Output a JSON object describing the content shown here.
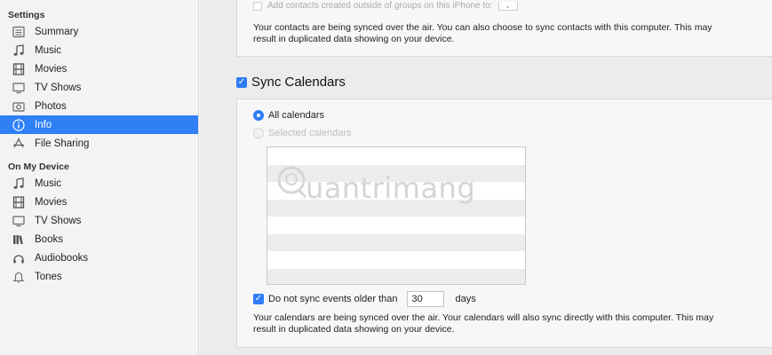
{
  "sidebar": {
    "settings_heading": "Settings",
    "settings_items": [
      {
        "label": "Summary",
        "icon": "summary-icon"
      },
      {
        "label": "Music",
        "icon": "music-note-icon"
      },
      {
        "label": "Movies",
        "icon": "film-icon"
      },
      {
        "label": "TV Shows",
        "icon": "tv-icon"
      },
      {
        "label": "Photos",
        "icon": "camera-icon"
      },
      {
        "label": "Info",
        "icon": "info-icon",
        "selected": true
      },
      {
        "label": "File Sharing",
        "icon": "app-store-icon"
      }
    ],
    "device_heading": "On My Device",
    "device_items": [
      {
        "label": "Music",
        "icon": "music-note-icon"
      },
      {
        "label": "Movies",
        "icon": "film-icon"
      },
      {
        "label": "TV Shows",
        "icon": "tv-icon"
      },
      {
        "label": "Books",
        "icon": "books-icon"
      },
      {
        "label": "Audiobooks",
        "icon": "headphones-icon"
      },
      {
        "label": "Tones",
        "icon": "bell-icon"
      }
    ],
    "active_color": "#2f80f5"
  },
  "contacts": {
    "cut_option_text": "Add contacts created outside of groups on this iPhone to:",
    "description_line1": "Your contacts are being synced over the air. You can also choose to sync contacts with this computer. This may",
    "description_line2": "result in duplicated data showing on your device."
  },
  "calendars": {
    "sync_label": "Sync Calendars",
    "sync_checked": true,
    "all_calendars_label": "All calendars",
    "selected_calendars_label": "Selected calendars",
    "selected_option": "All calendars",
    "old_events_label": "Do not sync events older than",
    "old_events_checked": true,
    "old_events_value": "30",
    "days_label": "days",
    "description_line1": "Your calendars are being synced over the air. Your calendars will also sync directly with this computer. This may",
    "description_line2": "result in duplicated data showing on your device."
  },
  "watermark": {
    "text": "uantrimang"
  },
  "accent_color": "#2e7cf6"
}
